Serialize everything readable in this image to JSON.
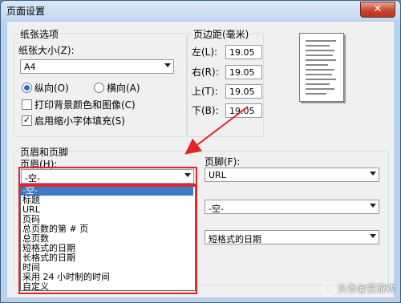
{
  "window": {
    "title": "页面设置",
    "close_glyph": "✕"
  },
  "paper": {
    "group_label": "纸张选项",
    "size_label": "纸张大小(Z):",
    "size_value": "A4",
    "orientation": {
      "portrait": "纵向(O)",
      "landscape": "横向(A)",
      "selected": "portrait"
    },
    "print_bg_label": "打印背景颜色和图像(C)",
    "print_bg_checked": false,
    "shrink_label": "启用缩小字体填充(S)",
    "shrink_checked": true
  },
  "margins": {
    "group_label": "页边距(毫米)",
    "left_label": "左(L):",
    "left_value": "19.05",
    "right_label": "右(R):",
    "right_value": "19.05",
    "top_label": "上(T):",
    "top_value": "19.05",
    "bottom_label": "下(B):",
    "bottom_value": "19.05"
  },
  "header_footer": {
    "group_label": "页眉和页脚",
    "header_label": "页眉(H):",
    "header_value": "-空-",
    "footer_label": "页脚(F):",
    "footer_values": [
      "URL",
      "-空-",
      "短格式的日期"
    ],
    "options": [
      "-空-",
      "标题",
      "URL",
      "页码",
      "总页数的第 # 页",
      "总页数",
      "短格式的日期",
      "长格式的日期",
      "时间",
      "采用 24 小时制的时间",
      "自定义"
    ]
  },
  "watermark_text": "头条@爱游戏",
  "colors": {
    "highlight": "#3d78c6",
    "annotation_red": "#e0262a"
  }
}
